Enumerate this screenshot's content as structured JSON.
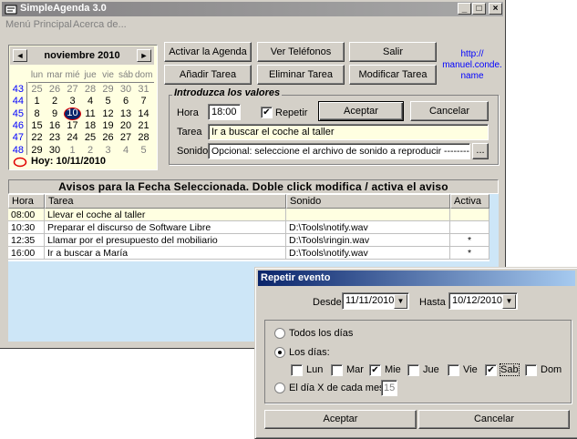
{
  "window": {
    "title": "SimpleAgenda 3.0",
    "controls": {
      "minimize": "_",
      "maximize": "□",
      "close": "×"
    }
  },
  "menu": {
    "items": [
      "Menú Principal",
      "Acerca de..."
    ]
  },
  "calendar": {
    "month_title": "noviembre 2010",
    "prev": "◄",
    "next": "►",
    "weekdays": [
      "lun",
      "mar",
      "mié",
      "jue",
      "vie",
      "sáb",
      "dom"
    ],
    "weeks": [
      {
        "num": "43",
        "days": [
          {
            "d": "25",
            "o": true
          },
          {
            "d": "26",
            "o": true
          },
          {
            "d": "27",
            "o": true
          },
          {
            "d": "28",
            "o": true
          },
          {
            "d": "29",
            "o": true
          },
          {
            "d": "30",
            "o": true
          },
          {
            "d": "31",
            "o": true
          }
        ]
      },
      {
        "num": "44",
        "days": [
          {
            "d": "1"
          },
          {
            "d": "2"
          },
          {
            "d": "3"
          },
          {
            "d": "4"
          },
          {
            "d": "5"
          },
          {
            "d": "6"
          },
          {
            "d": "7"
          }
        ]
      },
      {
        "num": "45",
        "days": [
          {
            "d": "8"
          },
          {
            "d": "9"
          },
          {
            "d": "10",
            "today": true
          },
          {
            "d": "11"
          },
          {
            "d": "12"
          },
          {
            "d": "13"
          },
          {
            "d": "14"
          }
        ]
      },
      {
        "num": "46",
        "days": [
          {
            "d": "15"
          },
          {
            "d": "16"
          },
          {
            "d": "17"
          },
          {
            "d": "18"
          },
          {
            "d": "19"
          },
          {
            "d": "20"
          },
          {
            "d": "21"
          }
        ]
      },
      {
        "num": "47",
        "days": [
          {
            "d": "22"
          },
          {
            "d": "23"
          },
          {
            "d": "24"
          },
          {
            "d": "25"
          },
          {
            "d": "26"
          },
          {
            "d": "27"
          },
          {
            "d": "28"
          }
        ]
      },
      {
        "num": "48",
        "days": [
          {
            "d": "29"
          },
          {
            "d": "30"
          },
          {
            "d": "1",
            "o": true
          },
          {
            "d": "2",
            "o": true
          },
          {
            "d": "3",
            "o": true
          },
          {
            "d": "4",
            "o": true
          },
          {
            "d": "5",
            "o": true
          }
        ]
      }
    ],
    "today_label": "Hoy: 10/11/2010",
    "today_color": "#e00000"
  },
  "toolbar": {
    "activar": "Activar la Agenda",
    "ver_telefonos": "Ver Teléfonos",
    "salir": "Salir",
    "anadir": "Añadir Tarea",
    "eliminar": "Eliminar Tarea",
    "modificar": "Modificar Tarea",
    "link": "http://\nmanuel.conde.\nname",
    "link_color": "#0000ff"
  },
  "form": {
    "group_title": "Introduzca los valores",
    "hora_label": "Hora",
    "hora_value": "18:00",
    "repetir_label": "Repetir",
    "repetir_checked": true,
    "aceptar": "Aceptar",
    "cancelar": "Cancelar",
    "tarea_label": "Tarea",
    "tarea_value": "Ir a buscar el coche al taller",
    "sonido_label": "Sonido",
    "sonido_value": "Opcional: seleccione el archivo de sonido a reproducir  ---------------->",
    "browse": "..."
  },
  "table": {
    "header_title": "Avisos para la Fecha Seleccionada. Doble click modifica / activa el aviso",
    "columns": [
      "Hora",
      "Tarea",
      "Sonido",
      "Activa"
    ],
    "rows": [
      {
        "hora": "08:00",
        "tarea": "Llevar el coche al taller",
        "sonido": "",
        "activa": "",
        "highlight": true
      },
      {
        "hora": "10:30",
        "tarea": "Preparar el discurso de Software Libre",
        "sonido": "D:\\Tools\\notify.wav",
        "activa": ""
      },
      {
        "hora": "12:35",
        "tarea": "Llamar por el presupuesto del mobiliario",
        "sonido": "D:\\Tools\\ringin.wav",
        "activa": "*"
      },
      {
        "hora": "16:00",
        "tarea": "Ir a buscar a María",
        "sonido": "D:\\Tools\\notify.wav",
        "activa": "*"
      }
    ]
  },
  "dialog": {
    "title": "Repetir evento",
    "desde_label": "Desde",
    "desde_value": "11/11/2010",
    "hasta_label": "Hasta",
    "hasta_value": "10/12/2010",
    "todos_label": "Todos los días",
    "dias_label": "Los días:",
    "days": [
      {
        "label": "Lun",
        "checked": false
      },
      {
        "label": "Mar",
        "checked": false
      },
      {
        "label": "Mie",
        "checked": true
      },
      {
        "label": "Jue",
        "checked": false
      },
      {
        "label": "Vie",
        "checked": false
      },
      {
        "label": "Sab",
        "checked": true
      },
      {
        "label": "Dom",
        "checked": false
      }
    ],
    "cada_mes_label": "El día X de cada mes",
    "cada_mes_value": "15",
    "selected_option": "dias",
    "aceptar": "Aceptar",
    "cancelar": "Cancelar"
  }
}
